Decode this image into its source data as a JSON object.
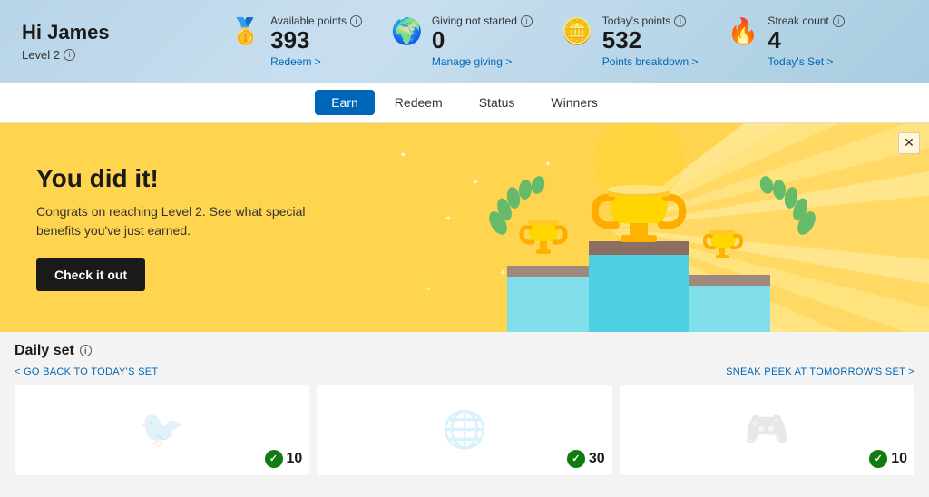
{
  "header": {
    "greeting": "Hi James",
    "level": "Level 2",
    "level_info_label": "info",
    "stats": [
      {
        "id": "available-points",
        "icon": "🥇",
        "label": "Available points",
        "value": "393",
        "link_text": "Redeem >",
        "link_id": "redeem-link"
      },
      {
        "id": "giving",
        "icon": "🌍",
        "label": "Giving not started",
        "value": "0",
        "link_text": "Manage giving >",
        "link_id": "manage-giving-link"
      },
      {
        "id": "todays-points",
        "icon": "🪙",
        "label": "Today's points",
        "value": "532",
        "link_text": "Points breakdown >",
        "link_id": "points-breakdown-link"
      },
      {
        "id": "streak-count",
        "icon": "🔥",
        "label": "Streak count",
        "value": "4",
        "link_text": "Today's Set >",
        "link_id": "todays-set-link"
      }
    ]
  },
  "tabs": [
    {
      "id": "earn",
      "label": "Earn",
      "active": true
    },
    {
      "id": "redeem",
      "label": "Redeem",
      "active": false
    },
    {
      "id": "status",
      "label": "Status",
      "active": false
    },
    {
      "id": "winners",
      "label": "Winners",
      "active": false
    }
  ],
  "banner": {
    "title": "You did it!",
    "description": "Congrats on reaching Level 2. See what special benefits you've just earned.",
    "cta_label": "Check it out",
    "close_label": "✕"
  },
  "daily_set": {
    "title": "Daily set",
    "nav_back": "< GO BACK TO TODAY'S SET",
    "nav_forward": "SNEAK PEEK AT TOMORROW'S SET >",
    "cards": [
      {
        "id": "card-1",
        "points": 10,
        "checked": true,
        "emoji": "🐦"
      },
      {
        "id": "card-2",
        "points": 30,
        "checked": true,
        "emoji": "🌐"
      },
      {
        "id": "card-3",
        "points": 10,
        "checked": true,
        "emoji": "🎮"
      }
    ]
  },
  "colors": {
    "accent_blue": "#0067b8",
    "active_tab_bg": "#0067b8",
    "banner_bg": "#ffd54f",
    "check_green": "#107c10"
  }
}
